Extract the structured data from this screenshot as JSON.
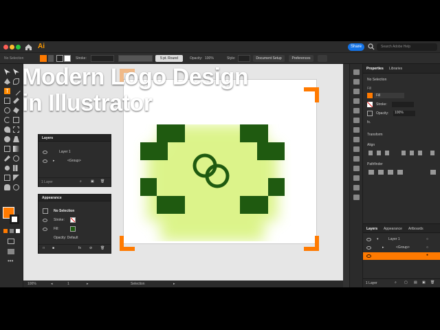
{
  "window": {
    "app_logo": "Ai",
    "share_label": "Share",
    "search_placeholder": "Search Adobe Help",
    "traffic_colors": [
      "#ff5f57",
      "#febc2e",
      "#28c840"
    ]
  },
  "control_bar": {
    "left_label": "No Selection",
    "stroke_label": "Stroke:",
    "brush_label": "5 pt. Round",
    "opacity_label": "Opacity:",
    "opacity_value": "100%",
    "style_label": "Style:",
    "document_setup": "Document Setup",
    "preferences": "Preferences"
  },
  "headline": {
    "line1": "Modern Logo Design",
    "line2": "in Illustrator"
  },
  "layers_panel": {
    "title": "Layers",
    "rows": [
      {
        "label": "Layer 1"
      },
      {
        "label": "<Group>"
      }
    ],
    "footer": "1 Layer"
  },
  "appearance_panel": {
    "title": "Appearance",
    "selection": "No Selection",
    "stroke_label": "Stroke:",
    "fill_label": "Fill:",
    "opacity": "Opacity: Default"
  },
  "status_bar": {
    "zoom": "100%",
    "artboard_num": "1",
    "tool": "Selection"
  },
  "properties": {
    "tabs": [
      "Properties",
      "Libraries"
    ],
    "selection": "No Selection",
    "fill_section": "Fill",
    "fill_label": "Fill",
    "stroke_label": "Stroke:",
    "opacity_label": "Opacity:",
    "opacity_value": "100%",
    "fx_label": "fx.",
    "transform": "Transform",
    "align": "Align",
    "pathfinder": "Pathfinder"
  },
  "layers_dock": {
    "tabs": [
      "Layers",
      "Appearance",
      "Artboards"
    ],
    "rows": [
      {
        "label": "Layer 1"
      },
      {
        "label": "<Group>"
      }
    ],
    "footer": "1 Layer"
  },
  "colors": {
    "accent": "#ff7a00",
    "logo_green": "#1f5a10",
    "share_blue": "#1473e6",
    "panel_bg": "#2c2c2c"
  },
  "icons": {
    "home": "home-icon",
    "search": "search-icon",
    "eye": "eye-icon"
  }
}
